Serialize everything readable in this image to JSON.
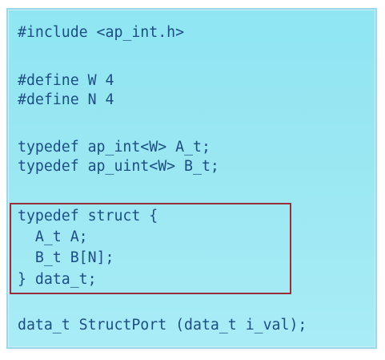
{
  "code": {
    "lines": [
      "#include <ap_int.h>",
      "#define W 4",
      "#define N 4",
      "typedef ap_int<W> A_t;",
      "typedef ap_uint<W> B_t;",
      "typedef struct {",
      "  A_t A;",
      "  B_t B[N];",
      "} data_t;",
      "data_t StructPort (data_t i_val);"
    ]
  },
  "colors": {
    "panel_background": "#99e7f2",
    "code_text": "#1c4e83",
    "highlight_border": "#9a2f3c"
  }
}
